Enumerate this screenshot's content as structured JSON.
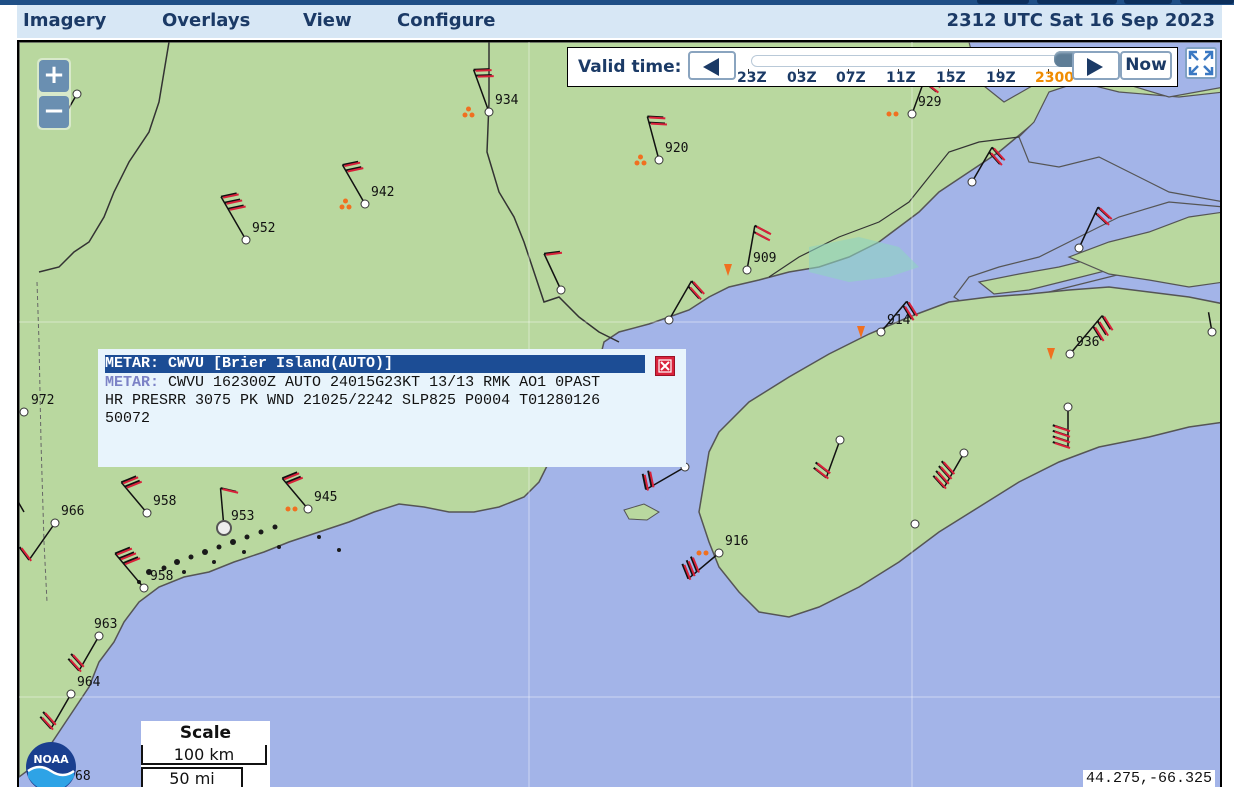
{
  "menu": {
    "items": [
      {
        "label": "Imagery"
      },
      {
        "label": "Overlays"
      },
      {
        "label": "View"
      },
      {
        "label": "Configure"
      }
    ],
    "datetime": "2312 UTC Sat 16 Sep 2023"
  },
  "time_control": {
    "label": "Valid time:",
    "now_label": "Now",
    "ticks": [
      "23Z",
      "03Z",
      "07Z",
      "11Z",
      "15Z",
      "19Z",
      "2300"
    ],
    "current": "2300",
    "highlight_color": "#f08c00"
  },
  "zoom": {
    "in": "+",
    "out": "−"
  },
  "popup": {
    "title": "METAR: CWVU [Brier Island(AUTO)]",
    "body_label": "METAR:",
    "body_line1": "CWVU 162300Z AUTO 24015G23KT 13/13 RMK AO1 0PAST",
    "body_line2": "HR PRESRR 3075 PK WND 21025/2242 SLP825 P0004 T01280126",
    "body_line3": "50072"
  },
  "stations": [
    "934",
    "929",
    "920",
    "942",
    "952",
    "909",
    "914",
    "936",
    "972",
    "966",
    "958",
    "945",
    "953",
    "958",
    "916",
    "963",
    "964",
    "68"
  ],
  "scale": {
    "title": "Scale",
    "km": "100 km",
    "mi": "50 mi"
  },
  "coordinates": "44.275,-66.325",
  "logo_text": "NOAA",
  "colors": {
    "land": "#b9d89f",
    "water": "#a3b4e8",
    "menu": "#d7e7f5",
    "accent": "#1c4d95",
    "barb": "#d8213a"
  }
}
